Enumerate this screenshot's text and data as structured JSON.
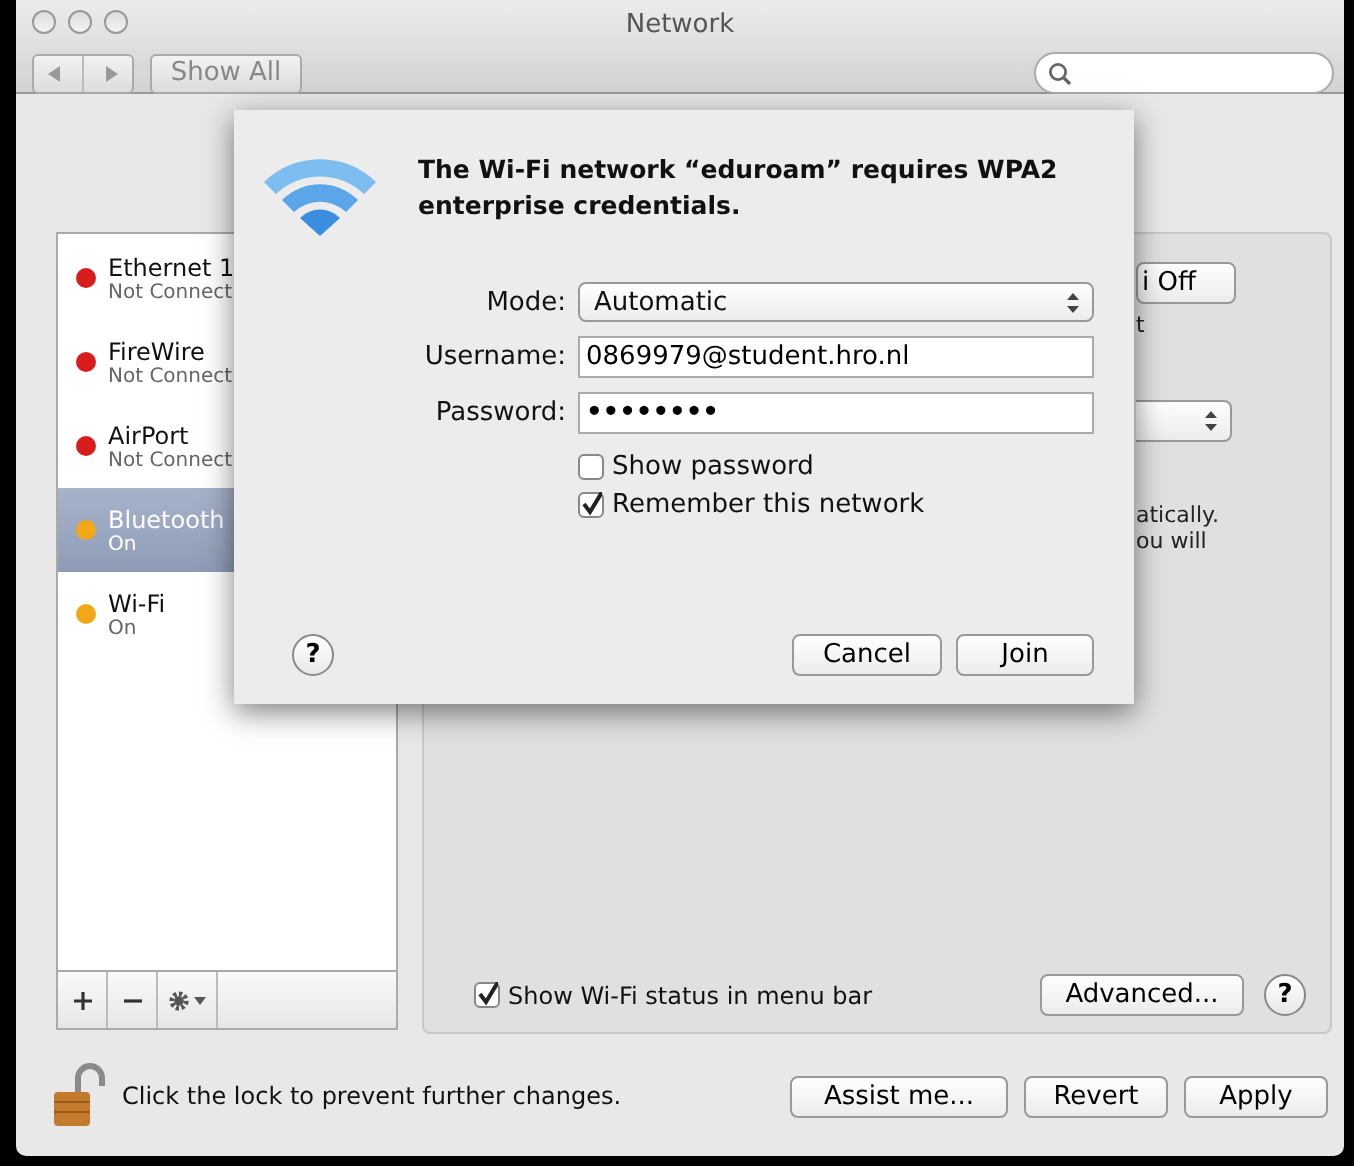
{
  "window": {
    "title": "Network"
  },
  "toolbar": {
    "show_all": "Show All"
  },
  "sidebar": {
    "items": [
      {
        "name": "Ethernet 1",
        "status": "Not Connect",
        "color": "#d81c1c",
        "selected": false
      },
      {
        "name": "FireWire",
        "status": "Not Connect",
        "color": "#d81c1c",
        "selected": false
      },
      {
        "name": "AirPort",
        "status": "Not Connect",
        "color": "#d81c1c",
        "selected": false
      },
      {
        "name": "Bluetooth",
        "status": "On",
        "color": "#f0a818",
        "selected": true
      },
      {
        "name": "Wi-Fi",
        "status": "On",
        "color": "#f0a818",
        "selected": false
      }
    ]
  },
  "panel": {
    "power_button": "i Off",
    "fragment_1": "t",
    "fragment_2": "atically.",
    "fragment_3": "ou will",
    "show_status": {
      "label": "Show Wi-Fi status in menu bar",
      "checked": true
    },
    "advanced": "Advanced...",
    "help": "?"
  },
  "footer": {
    "lock_text": "Click the lock to prevent further changes.",
    "buttons": [
      "Assist me...",
      "Revert",
      "Apply"
    ]
  },
  "sheet": {
    "title": "The Wi-Fi network “eduroam” requires WPA2 enterprise credentials.",
    "fields": [
      {
        "kind": "popup",
        "label": "Mode:",
        "value": "Automatic"
      },
      {
        "kind": "text",
        "label": "Username:",
        "value": "0869979@student.hro.nl"
      },
      {
        "kind": "password",
        "label": "Password:",
        "value": "••••••••"
      }
    ],
    "options": [
      {
        "label": "Show password",
        "checked": false
      },
      {
        "label": "Remember this network",
        "checked": true
      }
    ],
    "help": "?",
    "buttons": [
      "Cancel",
      "Join"
    ]
  }
}
